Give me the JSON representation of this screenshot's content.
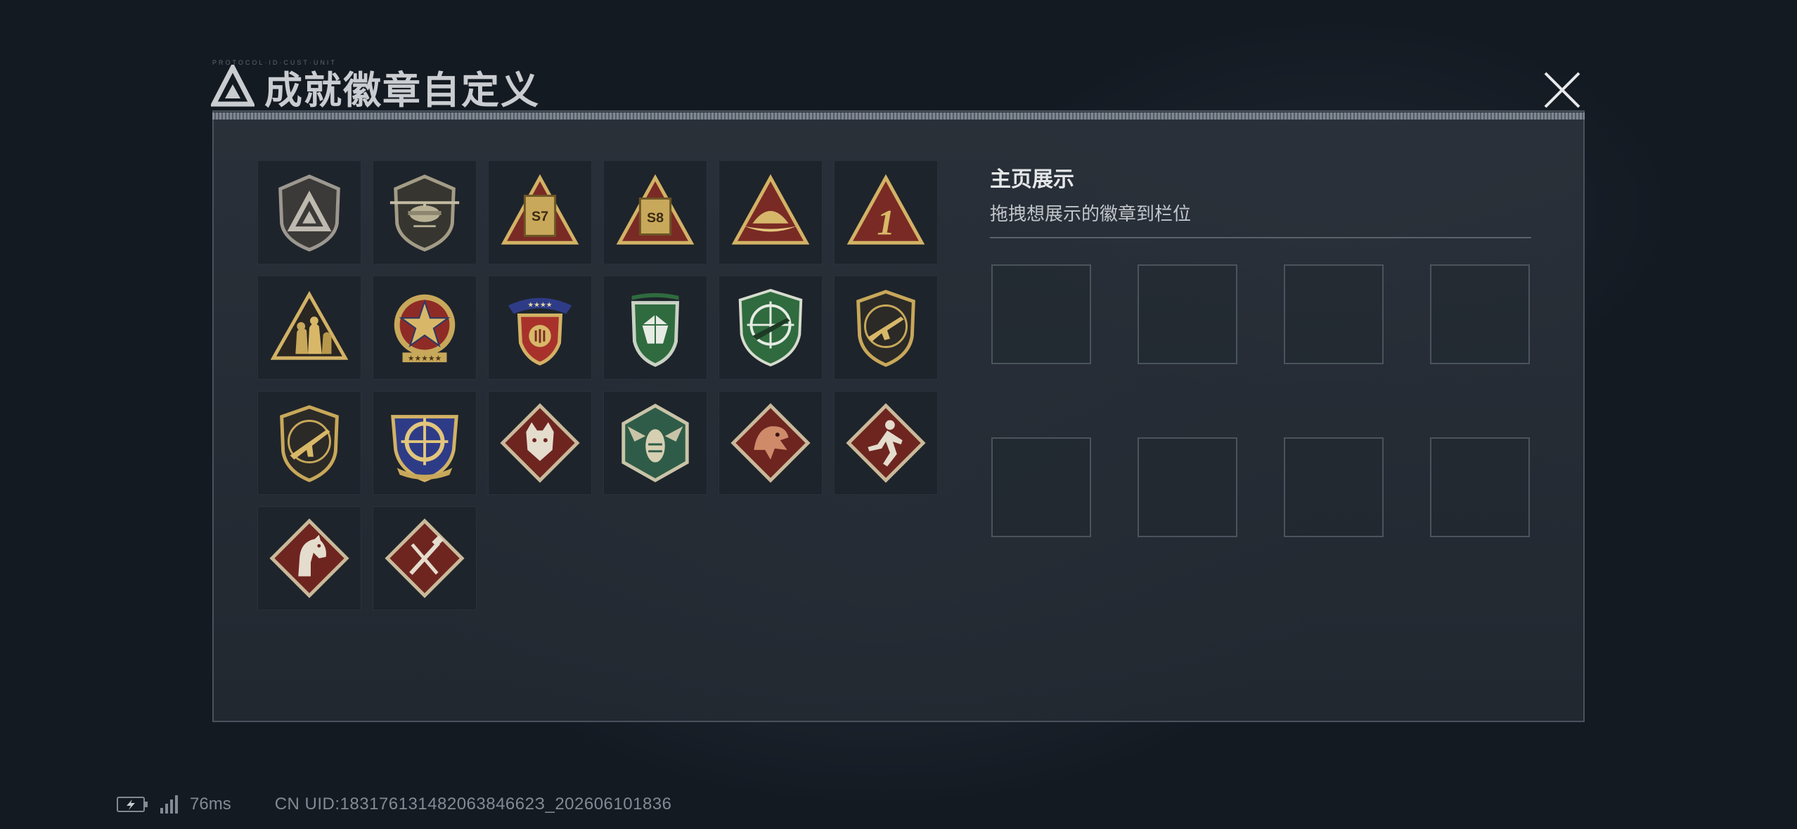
{
  "dialog": {
    "title": "成就徽章自定义",
    "tiny_header": "PROTOCOL·ID·CUST·UNIT"
  },
  "badges": [
    {
      "name": "shield-triangle-badge-icon"
    },
    {
      "name": "helicopter-badge-icon"
    },
    {
      "name": "s7-season-badge-icon",
      "label": "S7"
    },
    {
      "name": "s8-season-badge-icon",
      "label": "S8"
    },
    {
      "name": "hat-triangle-badge-icon"
    },
    {
      "name": "number-one-badge-icon",
      "label": "1"
    },
    {
      "name": "soldiers-triangle-badge-icon"
    },
    {
      "name": "star-medal-badge-icon"
    },
    {
      "name": "winged-shield-badge-icon"
    },
    {
      "name": "green-gem-shield-badge-icon"
    },
    {
      "name": "green-crosshair-rifle-badge-icon"
    },
    {
      "name": "gold-smg-shield-badge-icon"
    },
    {
      "name": "gold-rifle-shield-badge-icon"
    },
    {
      "name": "gold-crosshair-shield-badge-icon"
    },
    {
      "name": "wolf-diamond-badge-icon"
    },
    {
      "name": "hornet-hexagon-badge-icon"
    },
    {
      "name": "dragon-diamond-badge-icon"
    },
    {
      "name": "runner-diamond-badge-icon"
    },
    {
      "name": "horse-diamond-badge-icon"
    },
    {
      "name": "tools-diamond-badge-icon"
    }
  ],
  "showcase": {
    "title": "主页展示",
    "subtitle": "拖拽想展示的徽章到栏位",
    "slot_count": 8
  },
  "status": {
    "ping": "76ms",
    "uid": "CN UID:18317613148206384662З_202606101836"
  },
  "colors": {
    "gold": "#c8a85a",
    "dark_red": "#7a2a24",
    "green": "#2f6b3e",
    "panel_border": "#4a525c"
  }
}
